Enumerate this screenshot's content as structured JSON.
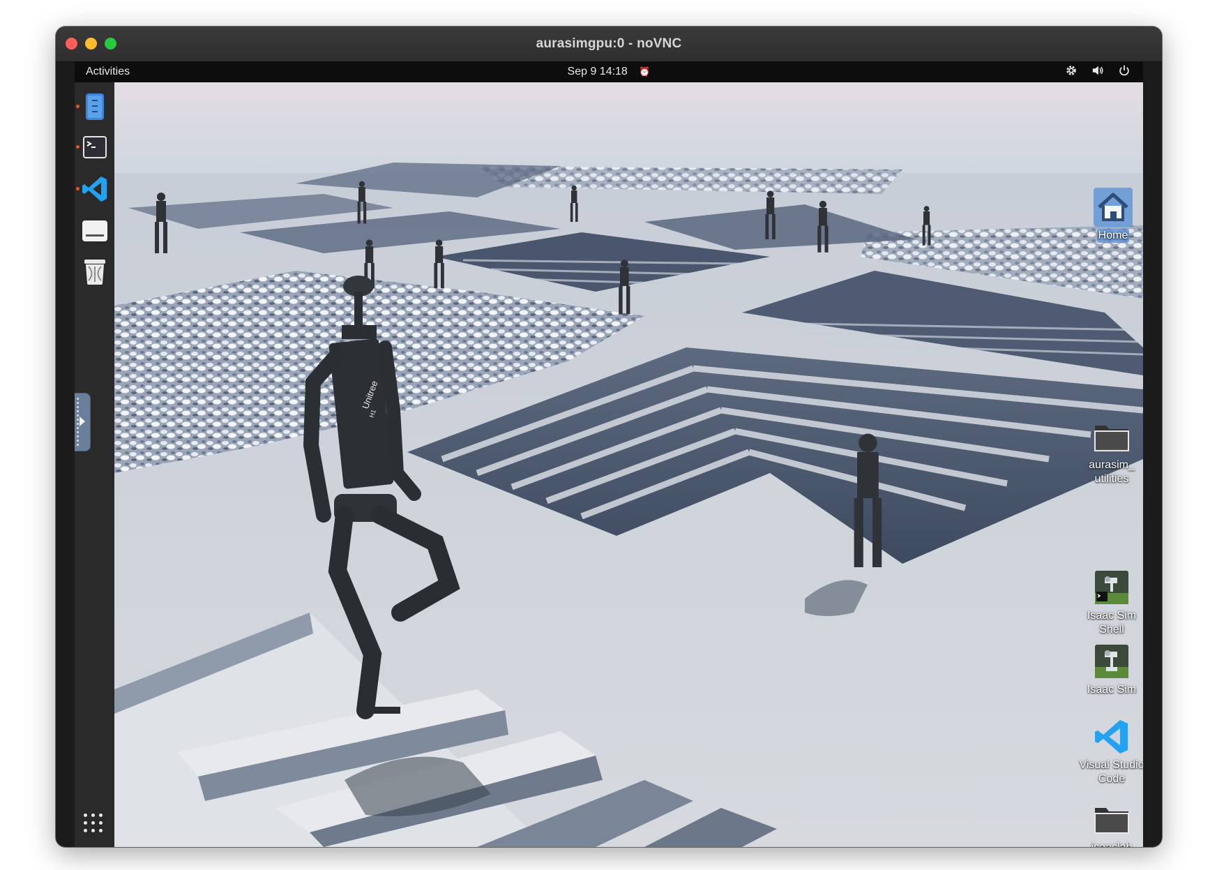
{
  "window": {
    "title": "aurasimgpu:0 - noVNC"
  },
  "topbar": {
    "activities": "Activities",
    "clock": "Sep 9  14:18",
    "alarm_icon": "alarm-clock-icon",
    "tray_icons": [
      "settings-icon",
      "volume-icon",
      "power-icon"
    ]
  },
  "dock": {
    "items": [
      {
        "name": "files",
        "icon": "file-manager-icon",
        "running": true
      },
      {
        "name": "terminal",
        "icon": "terminal-icon",
        "running": true
      },
      {
        "name": "vscode",
        "icon": "vscode-icon",
        "running": true
      },
      {
        "name": "drive",
        "icon": "drive-icon",
        "running": false
      },
      {
        "name": "trash",
        "icon": "trash-icon",
        "running": false
      }
    ],
    "apps_grid_icon": "show-applications-icon"
  },
  "desktop": {
    "icons": [
      {
        "label": "Home",
        "icon": "home-folder-icon",
        "selected": true
      },
      {
        "label": "aurasim_ utilities",
        "icon": "folder-icon",
        "selected": false
      },
      {
        "label": "Isaac Sim Shell",
        "icon": "isaac-sim-shell-icon",
        "selected": false
      },
      {
        "label": "Isaac Sim",
        "icon": "isaac-sim-icon",
        "selected": false
      },
      {
        "label": "Visual Studio Code",
        "icon": "vscode-icon",
        "selected": false
      },
      {
        "label": "isaaclab",
        "icon": "folder-icon",
        "selected": false
      }
    ]
  },
  "robot": {
    "chest_text": "Unitree",
    "chest_model": "H1"
  },
  "colors": {
    "titlebar": "#2e2e2e",
    "topbar": "#0d0d0d",
    "dock": "#2a2a2a",
    "accent_running": "#e95420",
    "selection": "#6496d7",
    "vscode_blue": "#22a2f0"
  }
}
